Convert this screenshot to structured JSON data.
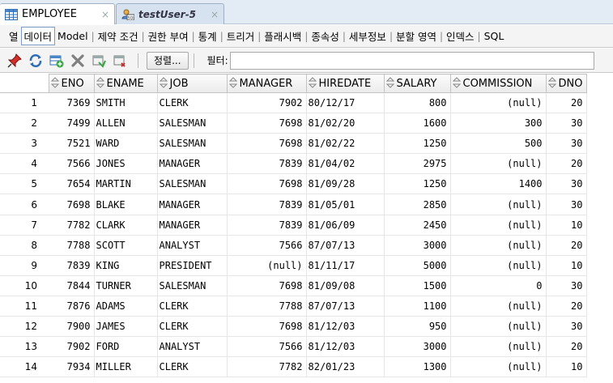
{
  "tabs": [
    {
      "label": "EMPLOYEE",
      "icon": "table-grid-icon",
      "active": true
    },
    {
      "label": "testUser-5",
      "icon": "sql-worksheet-icon",
      "active": false
    }
  ],
  "subnav": [
    "열",
    "데이터",
    "Model",
    "제약 조건",
    "권한 부여",
    "통계",
    "트리거",
    "플래시백",
    "종속성",
    "세부정보",
    "분할 영역",
    "인덱스",
    "SQL"
  ],
  "subnav_active": "데이터",
  "toolbar": {
    "icons": [
      "pin-icon",
      "refresh-icon",
      "insert-row-icon",
      "delete-row-icon",
      "commit-icon",
      "rollback-icon"
    ],
    "sort_label": "정렬...",
    "filter_label": "필터:",
    "filter_value": ""
  },
  "colors": {
    "tab_bg": "#e3ebf5",
    "icon_blue": "#2f6db5",
    "delete_red": "#c03030"
  },
  "grid": {
    "columns": [
      "ENO",
      "ENAME",
      "JOB",
      "MANAGER",
      "HIREDATE",
      "SALARY",
      "COMMISSION",
      "DNO"
    ],
    "rows": [
      [
        "1",
        "7369",
        "SMITH",
        "CLERK",
        "7902",
        "80/12/17",
        "800",
        "(null)",
        "20"
      ],
      [
        "2",
        "7499",
        "ALLEN",
        "SALESMAN",
        "7698",
        "81/02/20",
        "1600",
        "300",
        "30"
      ],
      [
        "3",
        "7521",
        "WARD",
        "SALESMAN",
        "7698",
        "81/02/22",
        "1250",
        "500",
        "30"
      ],
      [
        "4",
        "7566",
        "JONES",
        "MANAGER",
        "7839",
        "81/04/02",
        "2975",
        "(null)",
        "20"
      ],
      [
        "5",
        "7654",
        "MARTIN",
        "SALESMAN",
        "7698",
        "81/09/28",
        "1250",
        "1400",
        "30"
      ],
      [
        "6",
        "7698",
        "BLAKE",
        "MANAGER",
        "7839",
        "81/05/01",
        "2850",
        "(null)",
        "30"
      ],
      [
        "7",
        "7782",
        "CLARK",
        "MANAGER",
        "7839",
        "81/06/09",
        "2450",
        "(null)",
        "10"
      ],
      [
        "8",
        "7788",
        "SCOTT",
        "ANALYST",
        "7566",
        "87/07/13",
        "3000",
        "(null)",
        "20"
      ],
      [
        "9",
        "7839",
        "KING",
        "PRESIDENT",
        "(null)",
        "81/11/17",
        "5000",
        "(null)",
        "10"
      ],
      [
        "10",
        "7844",
        "TURNER",
        "SALESMAN",
        "7698",
        "81/09/08",
        "1500",
        "0",
        "30"
      ],
      [
        "11",
        "7876",
        "ADAMS",
        "CLERK",
        "7788",
        "87/07/13",
        "1100",
        "(null)",
        "20"
      ],
      [
        "12",
        "7900",
        "JAMES",
        "CLERK",
        "7698",
        "81/12/03",
        "950",
        "(null)",
        "30"
      ],
      [
        "13",
        "7902",
        "FORD",
        "ANALYST",
        "7566",
        "81/12/03",
        "3000",
        "(null)",
        "20"
      ],
      [
        "14",
        "7934",
        "MILLER",
        "CLERK",
        "7782",
        "82/01/23",
        "1300",
        "(null)",
        "10"
      ]
    ]
  }
}
